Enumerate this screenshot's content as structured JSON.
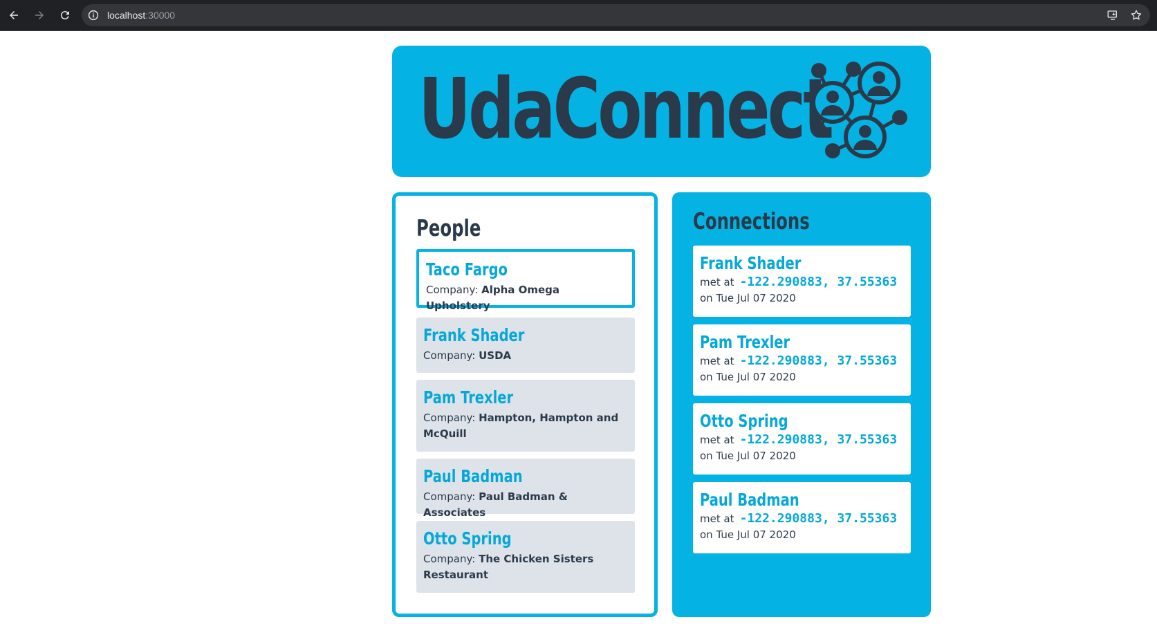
{
  "browser": {
    "url_host": "localhost",
    "url_port": ":30000"
  },
  "header": {
    "brand": "UdaConnect",
    "logo_icon": "network-people-icon",
    "colors": {
      "accent": "#04b3e4",
      "dark": "#2b3a4a",
      "card": "#dde3e9"
    }
  },
  "people": {
    "title": "People",
    "company_label": "Company:",
    "items": [
      {
        "name": "Taco Fargo",
        "company": "Alpha Omega Upholstery",
        "selected": true
      },
      {
        "name": "Frank Shader",
        "company": "USDA"
      },
      {
        "name": "Pam Trexler",
        "company": "Hampton, Hampton and McQuill"
      },
      {
        "name": "Paul Badman",
        "company": "Paul Badman & Associates"
      },
      {
        "name": "Otto Spring",
        "company": "The Chicken Sisters Restaurant"
      }
    ]
  },
  "connections": {
    "title": "Connections",
    "met_label": "met at",
    "items": [
      {
        "name": "Frank Shader",
        "coords": "-122.290883, 37.55363",
        "date": "on Tue Jul 07 2020"
      },
      {
        "name": "Pam Trexler",
        "coords": "-122.290883, 37.55363",
        "date": "on Tue Jul 07 2020"
      },
      {
        "name": "Otto Spring",
        "coords": "-122.290883, 37.55363",
        "date": "on Tue Jul 07 2020"
      },
      {
        "name": "Paul Badman",
        "coords": "-122.290883, 37.55363",
        "date": "on Tue Jul 07 2020"
      }
    ]
  }
}
